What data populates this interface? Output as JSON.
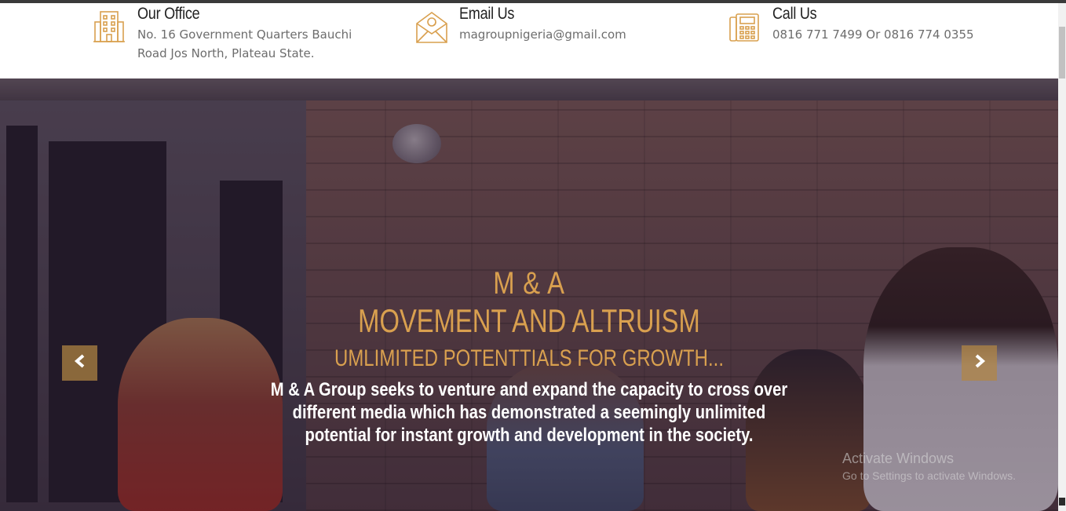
{
  "contact": {
    "office": {
      "title": "Our Office",
      "line1": "No. 16 Government Quarters Bauchi",
      "line2": "Road Jos North, Plateau State.",
      "icon": "building-icon"
    },
    "email": {
      "title": "Email Us",
      "line1": "magroupnigeria@gmail.com",
      "icon": "envelope-icon"
    },
    "call": {
      "title": "Call Us",
      "line1": "0816 771 7499 Or 0816 774 0355",
      "icon": "phone-icon"
    }
  },
  "hero": {
    "brand": "M & A",
    "title": "MOVEMENT AND ALTRUISM",
    "subtitle": "UMLIMITED POTENTTIALS FOR GROWTH...",
    "description": "M & A Group seeks to venture and expand the capacity to cross over different media which has demonstrated a seemingly unlimited potential for instant growth and development in the society."
  },
  "carousel": {
    "prev_icon": "chevron-left-icon",
    "next_icon": "chevron-right-icon"
  },
  "watermark": {
    "title": "Activate Windows",
    "subtitle": "Go to Settings to activate Windows."
  },
  "colors": {
    "accent": "#d9a04f",
    "button": "#b38642"
  }
}
